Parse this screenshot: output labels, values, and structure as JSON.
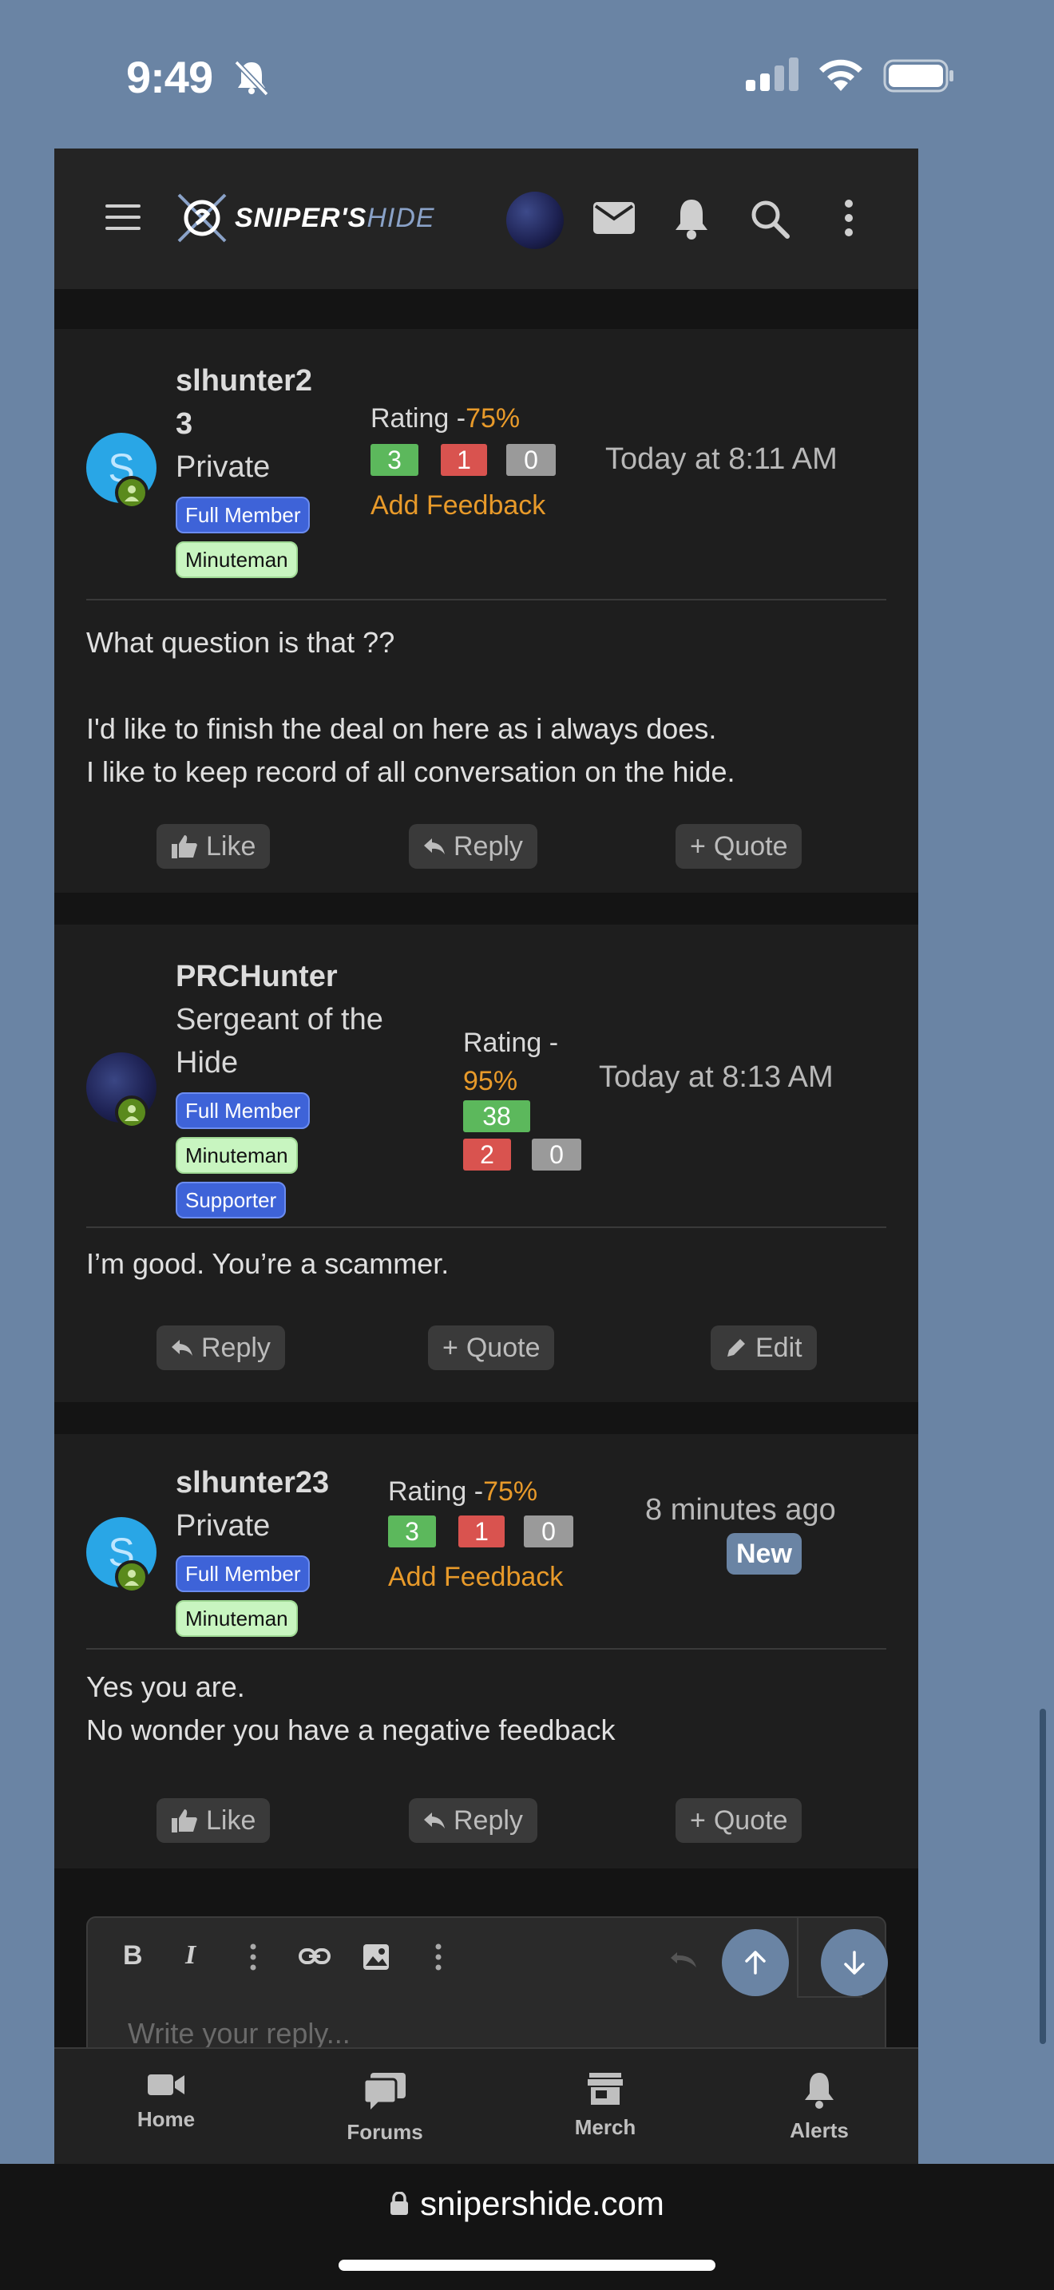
{
  "status_bar": {
    "time": "9:49"
  },
  "site": {
    "logo_main": "SNIPER'S",
    "logo_sub": "HIDE"
  },
  "posts": [
    {
      "username_line1": "slhunter2",
      "username_line2": "3",
      "title": "Private",
      "badges": [
        "Full Member",
        "Minuteman"
      ],
      "rating_label": "Rating -",
      "rating_pct": "75%",
      "pos": "3",
      "neg": "1",
      "neutral": "0",
      "add_feedback": "Add Feedback",
      "date": "Today at 8:11 AM",
      "message": [
        "What question is that ??",
        "",
        "I'd like to finish the deal on here as i always does.",
        "I like to keep record of all conversation on the hide."
      ],
      "buttons": [
        "Like",
        "Reply",
        "Quote"
      ]
    },
    {
      "username": "PRCHunter",
      "title_line1": "Sergeant of the",
      "title_line2": "Hide",
      "badges": [
        "Full Member",
        "Minuteman",
        "Supporter"
      ],
      "rating_label": "Rating -",
      "rating_pct": "95%",
      "pos": "38",
      "neg": "2",
      "neutral": "0",
      "date": "Today at 8:13 AM",
      "message": [
        "I’m good. You’re a scammer."
      ],
      "buttons": [
        "Reply",
        "Quote",
        "Edit"
      ]
    },
    {
      "username": "slhunter23",
      "title": "Private",
      "badges": [
        "Full Member",
        "Minuteman"
      ],
      "rating_label": "Rating -",
      "rating_pct": "75%",
      "pos": "3",
      "neg": "1",
      "neutral": "0",
      "add_feedback": "Add Feedback",
      "date": "8 minutes ago",
      "new_label": "New",
      "message": [
        "Yes you are.",
        "No wonder you have a negative feedback"
      ],
      "buttons": [
        "Like",
        "Reply",
        "Quote"
      ]
    }
  ],
  "editor": {
    "placeholder": "Write your reply..."
  },
  "bottom_nav": [
    "Home",
    "Forums",
    "Merch",
    "Alerts"
  ],
  "browser": {
    "url": "snipershide.com"
  },
  "colors": {
    "accent": "#6a84a4",
    "rating": "#e89a2a",
    "positive": "#5cb85c",
    "negative": "#d9534f"
  }
}
